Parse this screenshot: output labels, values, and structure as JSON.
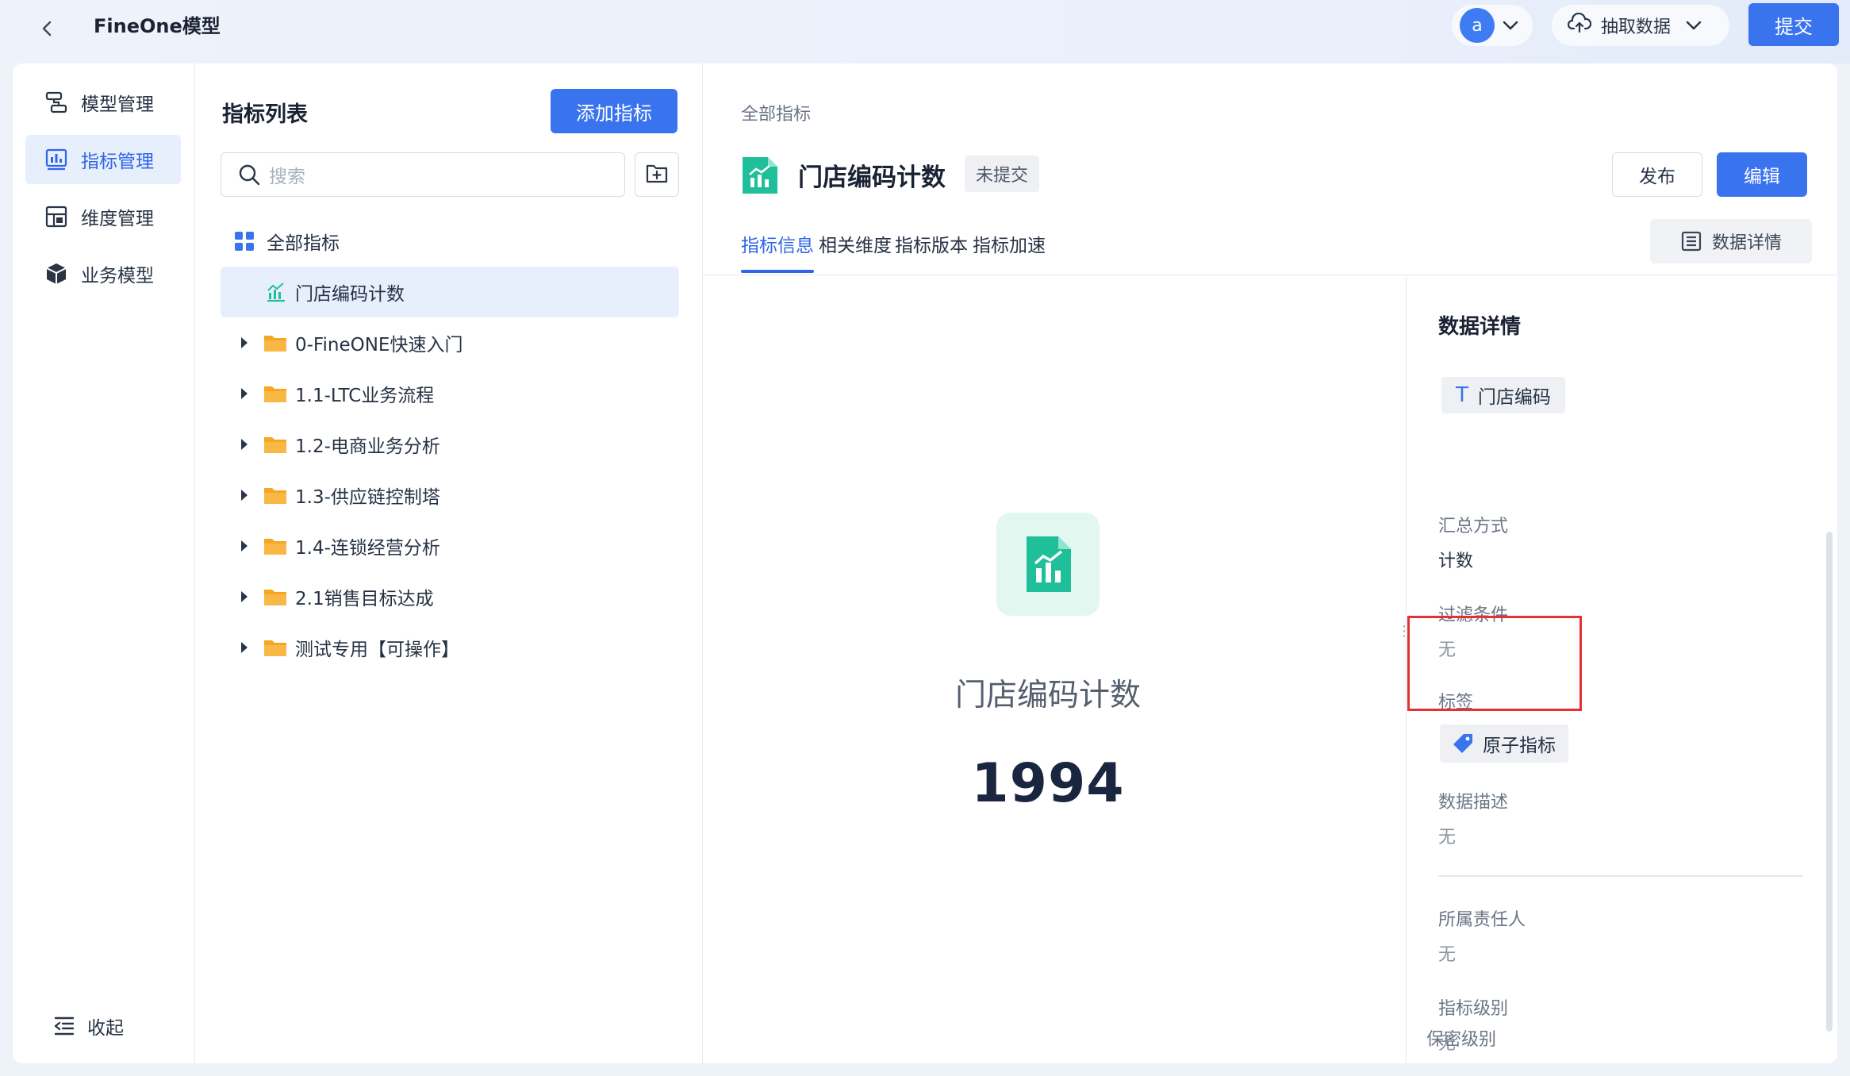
{
  "app": {
    "title": "FineOne模型"
  },
  "topbar": {
    "avatar_letter": "a",
    "extract_label": "抽取数据",
    "submit_label": "提交"
  },
  "nav": {
    "items": [
      {
        "label": "模型管理",
        "icon": "model-manage-icon"
      },
      {
        "label": "指标管理",
        "icon": "indicator-manage-icon",
        "active": true
      },
      {
        "label": "维度管理",
        "icon": "dimension-manage-icon"
      },
      {
        "label": "业务模型",
        "icon": "business-model-icon"
      }
    ],
    "collapse_label": "收起"
  },
  "list": {
    "title": "指标列表",
    "add_label": "添加指标",
    "search_placeholder": "搜索",
    "root_label": "全部指标",
    "selected_item": "门店编码计数",
    "folders": [
      "0-FineONE快速入门",
      "1.1-LTC业务流程",
      "1.2-电商业务分析",
      "1.3-供应链控制塔",
      "1.4-连锁经营分析",
      "2.1销售目标达成",
      "测试专用【可操作】"
    ]
  },
  "detail": {
    "breadcrumb": "全部指标",
    "title": "门店编码计数",
    "status": "未提交",
    "publish_label": "发布",
    "edit_label": "编辑",
    "tabs": [
      "指标信息",
      "相关维度",
      "指标版本",
      "指标加速"
    ],
    "active_tab": 0,
    "data_detail_label": "数据详情",
    "preview_name": "门店编码计数",
    "preview_value": "1994"
  },
  "side": {
    "title": "数据详情",
    "field_chip": "门店编码",
    "aggregation_label": "汇总方式",
    "aggregation_value": "计数",
    "filter_label": "过滤条件",
    "filter_value": "无",
    "tag_label": "标签",
    "tag_value": "原子指标",
    "desc_label": "数据描述",
    "desc_value": "无",
    "owner_label": "所属责任人",
    "owner_value": "无",
    "level_label": "指标级别",
    "level_value": "无",
    "secrecy_label": "保密级别"
  },
  "colors": {
    "primary": "#3a73ee",
    "accent_green": "#1fbf9a",
    "folder": "#f6a623",
    "highlight": "#e43131"
  }
}
